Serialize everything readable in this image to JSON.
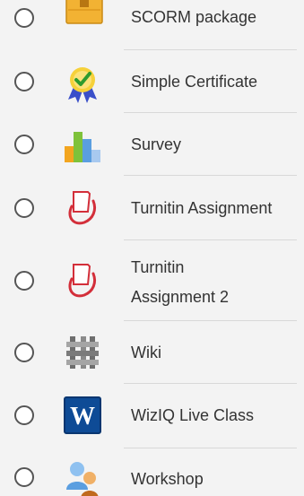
{
  "activity_list": {
    "items": [
      {
        "id": "scorm",
        "label": "SCORM package",
        "icon": "scorm-package-icon"
      },
      {
        "id": "certificate",
        "label": "Simple Certificate",
        "icon": "certificate-ribbon-icon"
      },
      {
        "id": "survey",
        "label": "Survey",
        "icon": "bar-chart-icon"
      },
      {
        "id": "turnitin",
        "label": "Turnitin Assignment",
        "icon": "turnitin-icon"
      },
      {
        "id": "turnitin2",
        "label_line1": "Turnitin",
        "label_line2": "Assignment 2",
        "icon": "turnitin-icon"
      },
      {
        "id": "wiki",
        "label": "Wiki",
        "icon": "wiki-icon"
      },
      {
        "id": "wiziq",
        "label": "WizIQ Live Class",
        "icon": "wiziq-icon"
      },
      {
        "id": "workshop",
        "label": "Workshop",
        "icon": "workshop-icon"
      }
    ]
  },
  "colors": {
    "background": "#f3f3f3",
    "divider": "#d8d8d8",
    "text": "#333333",
    "radio_border": "#555555"
  }
}
